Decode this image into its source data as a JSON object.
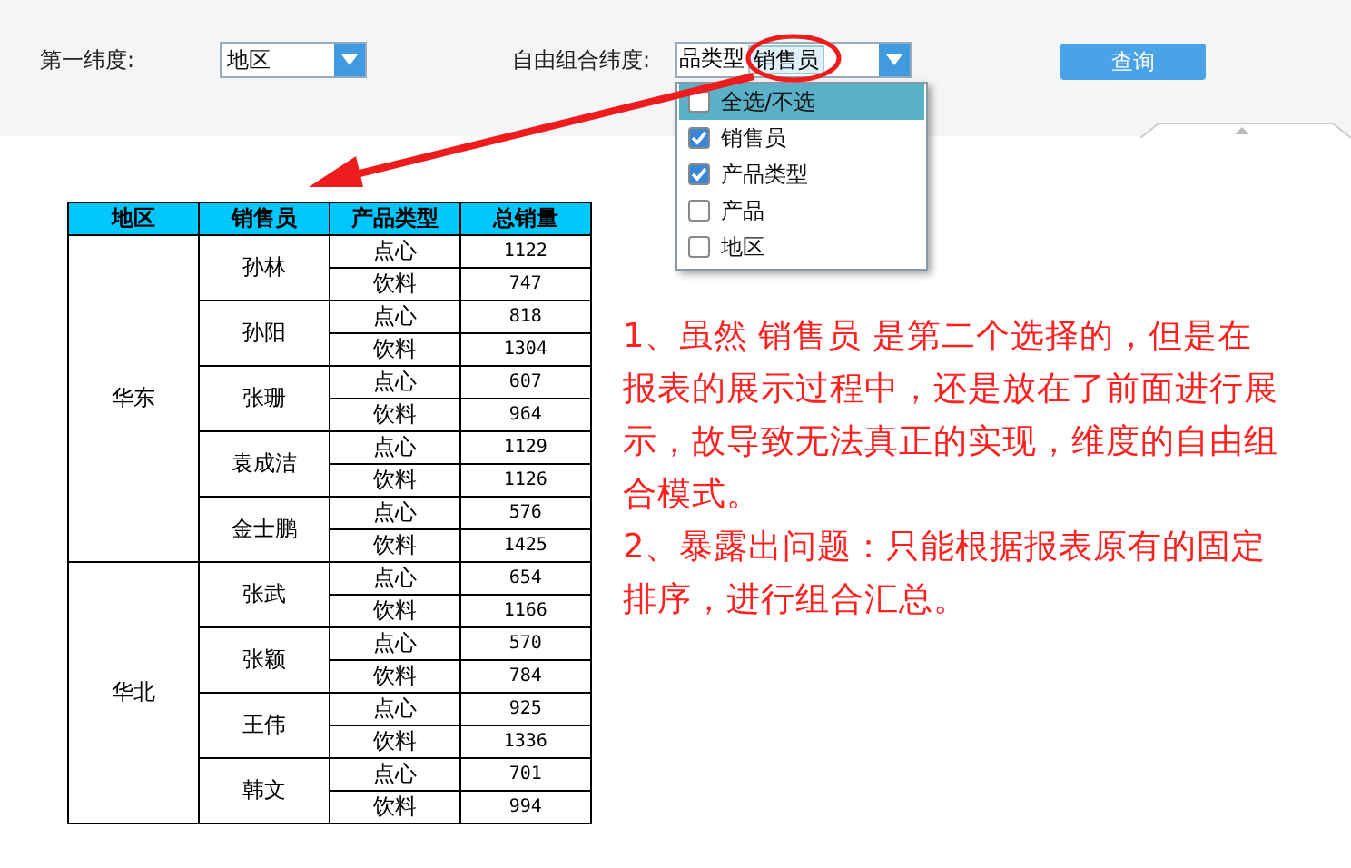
{
  "filters": {
    "first_dimension": {
      "label": "第一纬度:",
      "value": "地区"
    },
    "free_combination": {
      "label": "自由组合纬度:",
      "tags": [
        "品类型",
        "销售员"
      ],
      "options": [
        {
          "label": "全选/不选",
          "checked": false,
          "selected": true
        },
        {
          "label": "销售员",
          "checked": true,
          "selected": false
        },
        {
          "label": "产品类型",
          "checked": true,
          "selected": false
        },
        {
          "label": "产品",
          "checked": false,
          "selected": false
        },
        {
          "label": "地区",
          "checked": false,
          "selected": false
        }
      ]
    },
    "query_button": "查询"
  },
  "table": {
    "columns": [
      "地区",
      "销售员",
      "产品类型",
      "总销量"
    ],
    "regions": [
      {
        "name": "华东",
        "people": [
          {
            "name": "孙林",
            "rows": [
              [
                "点心",
                "1122"
              ],
              [
                "饮料",
                "747"
              ]
            ]
          },
          {
            "name": "孙阳",
            "rows": [
              [
                "点心",
                "818"
              ],
              [
                "饮料",
                "1304"
              ]
            ]
          },
          {
            "name": "张珊",
            "rows": [
              [
                "点心",
                "607"
              ],
              [
                "饮料",
                "964"
              ]
            ]
          },
          {
            "name": "袁成洁",
            "rows": [
              [
                "点心",
                "1129"
              ],
              [
                "饮料",
                "1126"
              ]
            ]
          },
          {
            "name": "金士鹏",
            "rows": [
              [
                "点心",
                "576"
              ],
              [
                "饮料",
                "1425"
              ]
            ]
          }
        ]
      },
      {
        "name": "华北",
        "people": [
          {
            "name": "张武",
            "rows": [
              [
                "点心",
                "654"
              ],
              [
                "饮料",
                "1166"
              ]
            ]
          },
          {
            "name": "张颖",
            "rows": [
              [
                "点心",
                "570"
              ],
              [
                "饮料",
                "784"
              ]
            ]
          },
          {
            "name": "王伟",
            "rows": [
              [
                "点心",
                "925"
              ],
              [
                "饮料",
                "1336"
              ]
            ]
          },
          {
            "name": "韩文",
            "rows": [
              [
                "点心",
                "701"
              ],
              [
                "饮料",
                "994"
              ]
            ]
          }
        ]
      }
    ]
  },
  "annotation": [
    "1、虽然 销售员 是第二个选择的，但是在报表的展示过程中，还是放在了前面进行展示，故导致无法真正的实现，维度的自由组合模式。",
    "2、暴露出问题：只能根据报表原有的固定排序，进行组合汇总。"
  ]
}
